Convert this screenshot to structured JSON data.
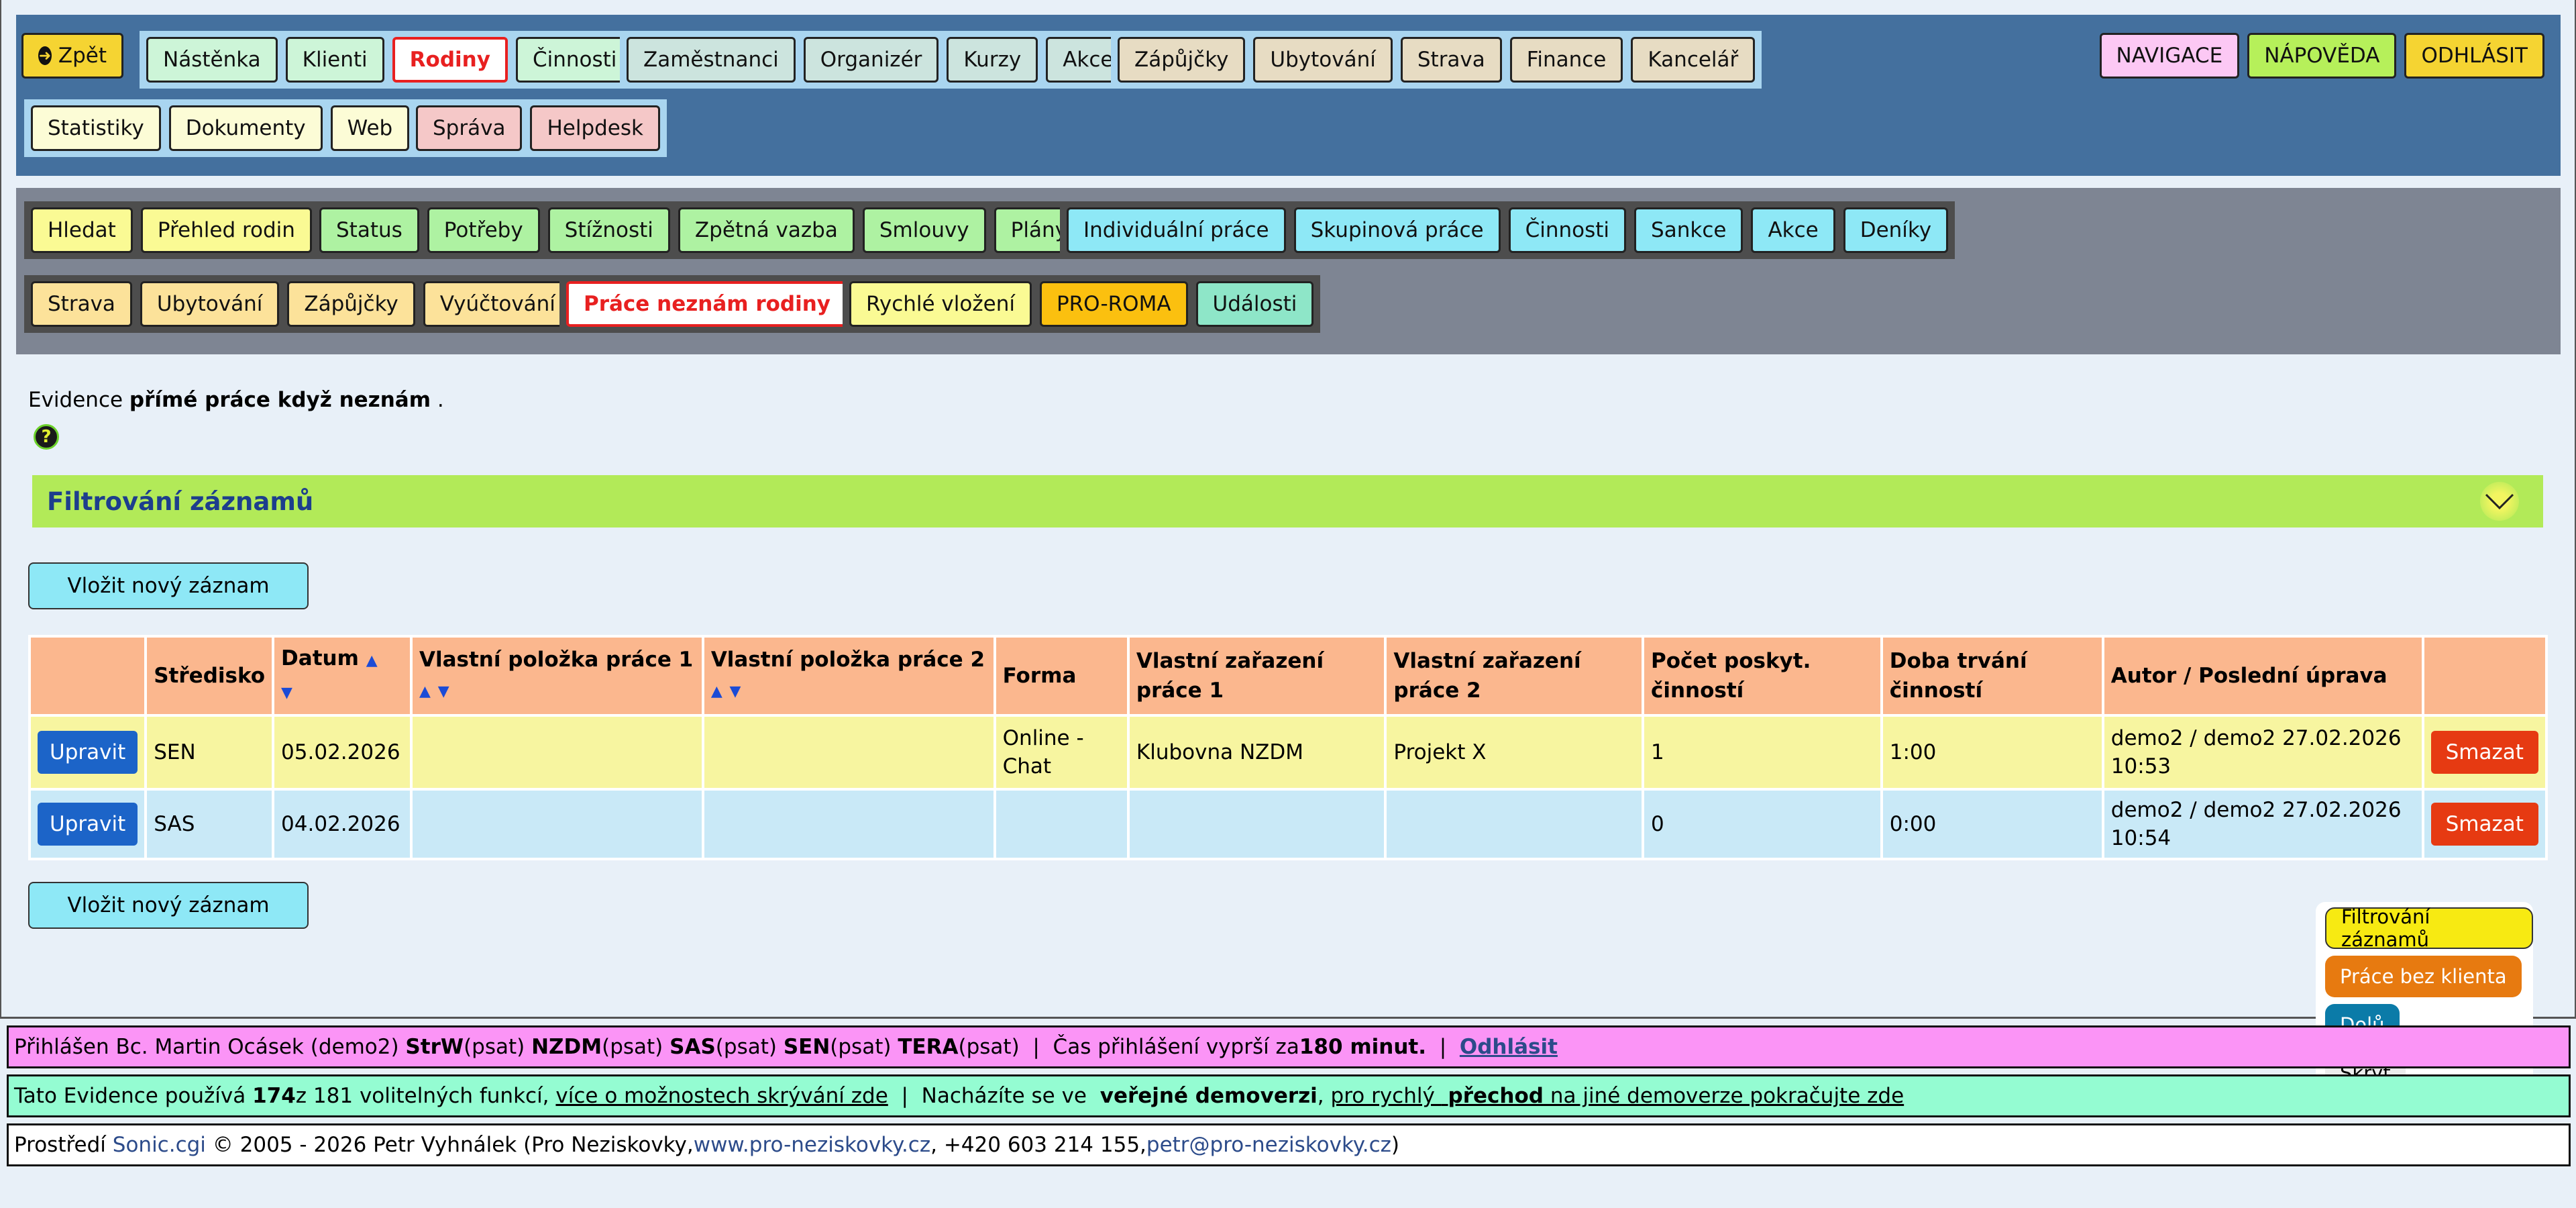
{
  "nav_top": {
    "back_label": "Zpět",
    "group1": [
      "Nástěnka",
      "Klienti",
      "Rodiny",
      "Činnosti"
    ],
    "group2": [
      "Zaměstnanci",
      "Organizér",
      "Kurzy",
      "Akce"
    ],
    "group3": [
      "Zápůjčky",
      "Ubytování",
      "Strava",
      "Finance",
      "Kancelář"
    ],
    "group4": [
      "Statistiky",
      "Dokumenty",
      "Web"
    ],
    "group5": [
      "Správa",
      "Helpdesk"
    ],
    "right": [
      "NAVIGACE",
      "NÁPOVĚDA",
      "ODHLÁSIT"
    ]
  },
  "nav_sub": {
    "g1": [
      "Hledat",
      "Přehled rodin"
    ],
    "g2": [
      "Status",
      "Potřeby",
      "Stížnosti",
      "Zpětná vazba",
      "Smlouvy",
      "Plány"
    ],
    "g3": [
      "Individuální práce",
      "Skupinová práce",
      "Činnosti",
      "Sankce",
      "Akce",
      "Deníky"
    ],
    "g4": [
      "Strava",
      "Ubytování",
      "Zápůjčky",
      "Vyúčtování"
    ],
    "g5": [
      "Práce neznám rodiny"
    ],
    "g6": [
      "Rychlé vložení",
      "PRO-ROMA",
      "Události"
    ]
  },
  "intro": {
    "prefix": "Evidence ",
    "bold": "přímé práce když neznám",
    "suffix": " ."
  },
  "filter": {
    "title": "Filtrování záznamů"
  },
  "new_record_label": "Vložit nový záznam",
  "table": {
    "headers": [
      "",
      "Středisko",
      "Datum",
      "Vlastní položka práce 1",
      "Vlastní položka práce 2",
      "Forma",
      "Vlastní zařazení práce 1",
      "Vlastní zařazení práce 2",
      "Počet poskyt. činností",
      "Doba trvání činností",
      "Autor / Poslední úprava",
      ""
    ],
    "rows": [
      {
        "edit": "Upravit",
        "stredisko": "SEN",
        "datum": "05.02.2026",
        "p1": "",
        "p2": "",
        "forma": "Online - Chat",
        "z1": "Klubovna NZDM",
        "z2": "Projekt X",
        "pocet": "1",
        "doba": "1:00",
        "autor": "demo2 / demo2 27.02.2026 10:53",
        "del": "Smazat"
      },
      {
        "edit": "Upravit",
        "stredisko": "SAS",
        "datum": "04.02.2026",
        "p1": "",
        "p2": "",
        "forma": "",
        "z1": "",
        "z2": "",
        "pocet": "0",
        "doba": "0:00",
        "autor": "demo2 / demo2 27.02.2026 10:54",
        "del": "Smazat"
      }
    ]
  },
  "floating": {
    "filter": "Filtrování záznamů",
    "noclient": "Práce bez klienta",
    "down": "Dolů",
    "hide": "Skrýt"
  },
  "status1": {
    "prefix": "Přihlášen Bc. Martin Ocásek (demo2) ",
    "items": [
      [
        "StrW",
        " (psat) "
      ],
      [
        "NZDM",
        " (psat) "
      ],
      [
        "SAS",
        " (psat) "
      ],
      [
        "SEN",
        " (psat) "
      ],
      [
        "TERA",
        " (psat)"
      ]
    ],
    "sep": "  |  ",
    "expire_prefix": "Čas přihlášení vyprší za ",
    "expire_value": "180 minut.",
    "logout": "Odhlásit"
  },
  "status2": {
    "t1": "Tato Evidence používá ",
    "used": "174",
    "t2": " z 181 volitelných funkcí, ",
    "link1": "více o možnostech skrývání zde",
    "t3": "  |  Nacházíte se ve ",
    "bold": "veřejné demoverzi",
    "t4": ", ",
    "link2a": "pro rychlý ",
    "link2b": "přechod",
    "link2c": " na jiné demoverze pokračujte zde"
  },
  "status3": {
    "t1": "Prostředí ",
    "brand": "Sonic.cgi",
    "t2": " © 2005 - 2026 Petr Vyhnálek (Pro Neziskovky, ",
    "web": "www.pro-neziskovky.cz",
    "t3": ", +420 603 214 155, ",
    "mail": "petr@pro-neziskovky.cz",
    "t4": ")"
  },
  "colors": {
    "top_bar": "#44709e",
    "sub_bar": "#7e8593",
    "filter_bar": "#b2ea58",
    "header": "#fbb78e",
    "row1": "#f7f5a0",
    "row2": "#c9e9f7",
    "active_border": "#e82020"
  }
}
